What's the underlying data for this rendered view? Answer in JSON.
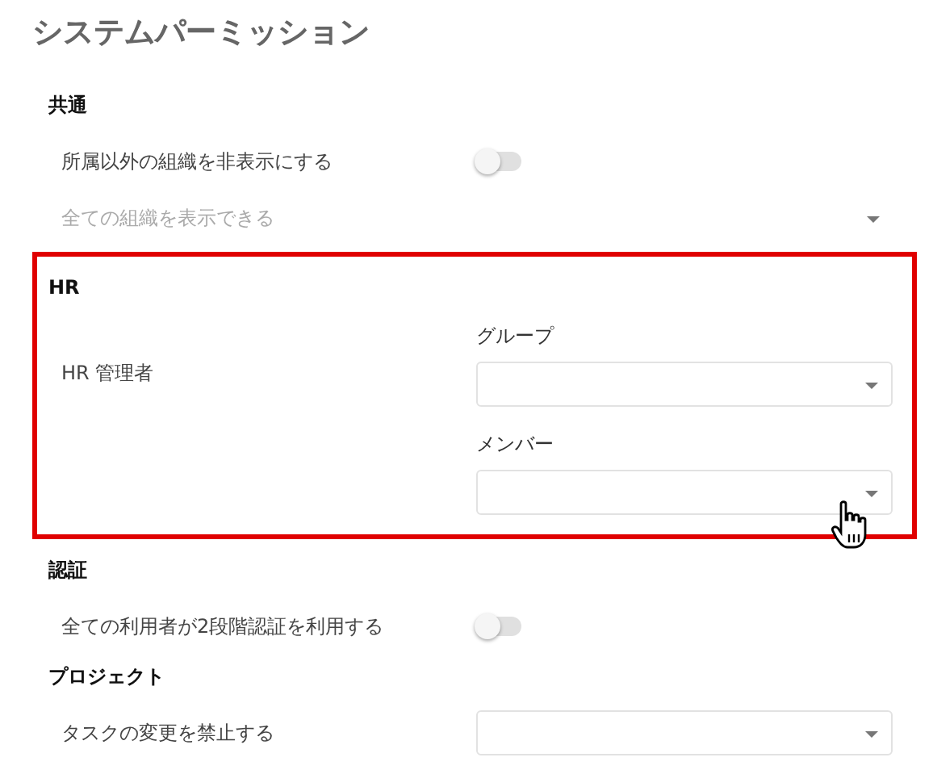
{
  "title": "システムパーミッション",
  "sections": [
    {
      "heading": "共通",
      "highlighted": false,
      "rows": [
        {
          "kind": "toggle",
          "label": "所属以外の組織を非表示にする",
          "on": false
        },
        {
          "kind": "dropdown",
          "placeholder": "全ての組織を表示できる"
        }
      ]
    },
    {
      "heading": "HR",
      "highlighted": true,
      "rows": [
        {
          "kind": "fields",
          "label": "HR 管理者",
          "fields": [
            {
              "label": "グループ"
            },
            {
              "label": "メンバー"
            }
          ]
        }
      ]
    },
    {
      "heading": "認証",
      "highlighted": false,
      "rows": [
        {
          "kind": "toggle",
          "label": "全ての利用者が2段階認証を利用する",
          "on": false
        }
      ]
    },
    {
      "heading": "プロジェクト",
      "highlighted": false,
      "rows": [
        {
          "kind": "select",
          "label": "タスクの変更を禁止する"
        }
      ]
    }
  ]
}
